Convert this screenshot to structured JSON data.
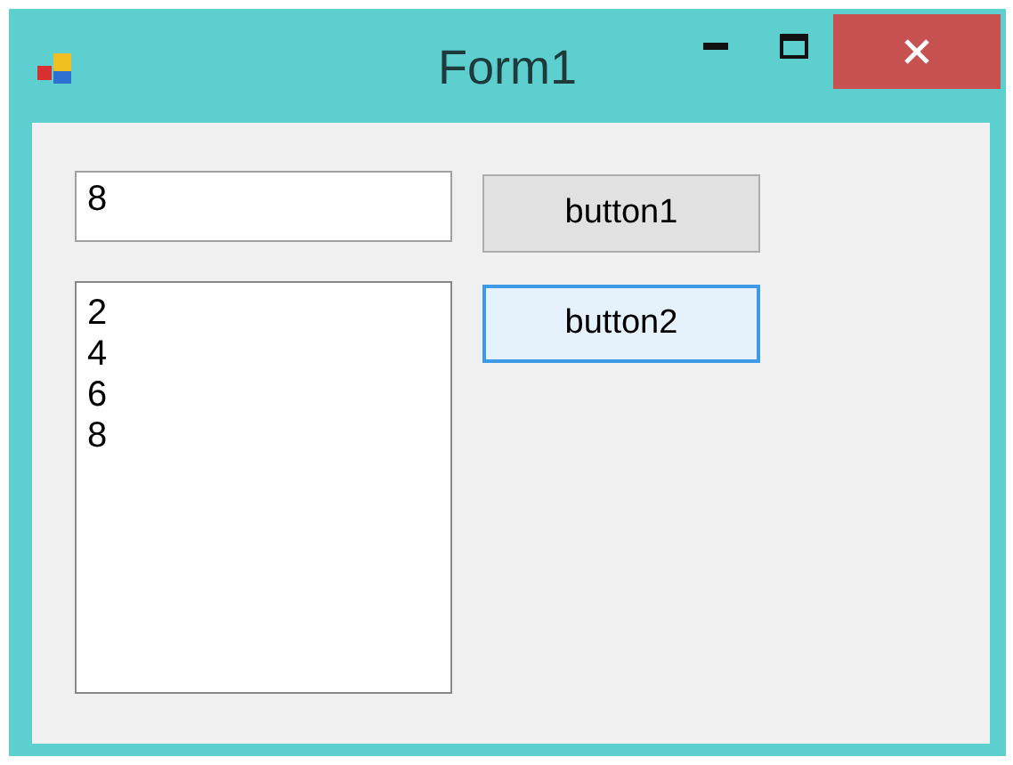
{
  "window": {
    "title": "Form1"
  },
  "textbox": {
    "value": "8"
  },
  "buttons": [
    {
      "label": "button1",
      "focused": false
    },
    {
      "label": "button2",
      "focused": true
    }
  ],
  "listbox": {
    "items": [
      "2",
      "4",
      "6",
      "8"
    ]
  }
}
